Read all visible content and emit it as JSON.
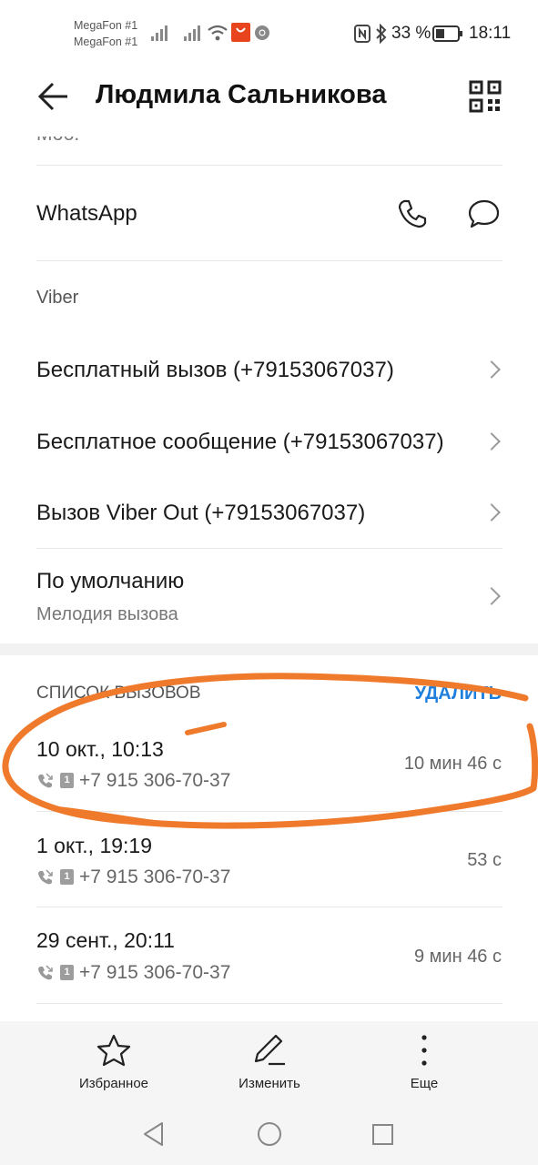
{
  "status_bar": {
    "carrier1": "MegaFon #1",
    "carrier2": "MegaFon #1",
    "battery": "33 %",
    "time": "18:11"
  },
  "header": {
    "title": "Людмила Сальникова"
  },
  "contact": {
    "partial_row": "Моб.",
    "whatsapp_label": "WhatsApp",
    "viber_section": "Viber",
    "viber_free_call": "Бесплатный вызов (+79153067037)",
    "viber_free_message": "Бесплатное сообщение (+79153067037)",
    "viber_out_call": "Вызов Viber Out (+79153067037)",
    "ringtone_title": "По умолчанию",
    "ringtone_subtitle": "Мелодия вызова"
  },
  "call_log": {
    "heading": "СПИСОК ВЫЗОВОВ",
    "delete_label": "УДАЛИТЬ",
    "calls": [
      {
        "date": "10 окт., 10:13",
        "number": "+7 915 306-70-37",
        "duration": "10 мин 46 с",
        "sim": "1"
      },
      {
        "date": "1 окт., 19:19",
        "number": "+7 915 306-70-37",
        "duration": "53 с",
        "sim": "1"
      },
      {
        "date": "29 сент., 20:11",
        "number": "+7 915 306-70-37",
        "duration": "9 мин 46 с",
        "sim": "1"
      }
    ]
  },
  "toolbar": {
    "favorite_label": "Избранное",
    "edit_label": "Изменить",
    "more_label": "Еще"
  },
  "colors": {
    "accent": "#1f7fdd",
    "annotation": "#f07a2c"
  },
  "icons": [
    "back-arrow-icon",
    "qr-code-icon",
    "phone-icon",
    "message-icon",
    "chevron-right-icon",
    "call-log-icon",
    "sim-icon",
    "star-icon",
    "pencil-icon",
    "more-vertical-icon",
    "nav-back-icon",
    "nav-home-icon",
    "nav-recents-icon"
  ]
}
